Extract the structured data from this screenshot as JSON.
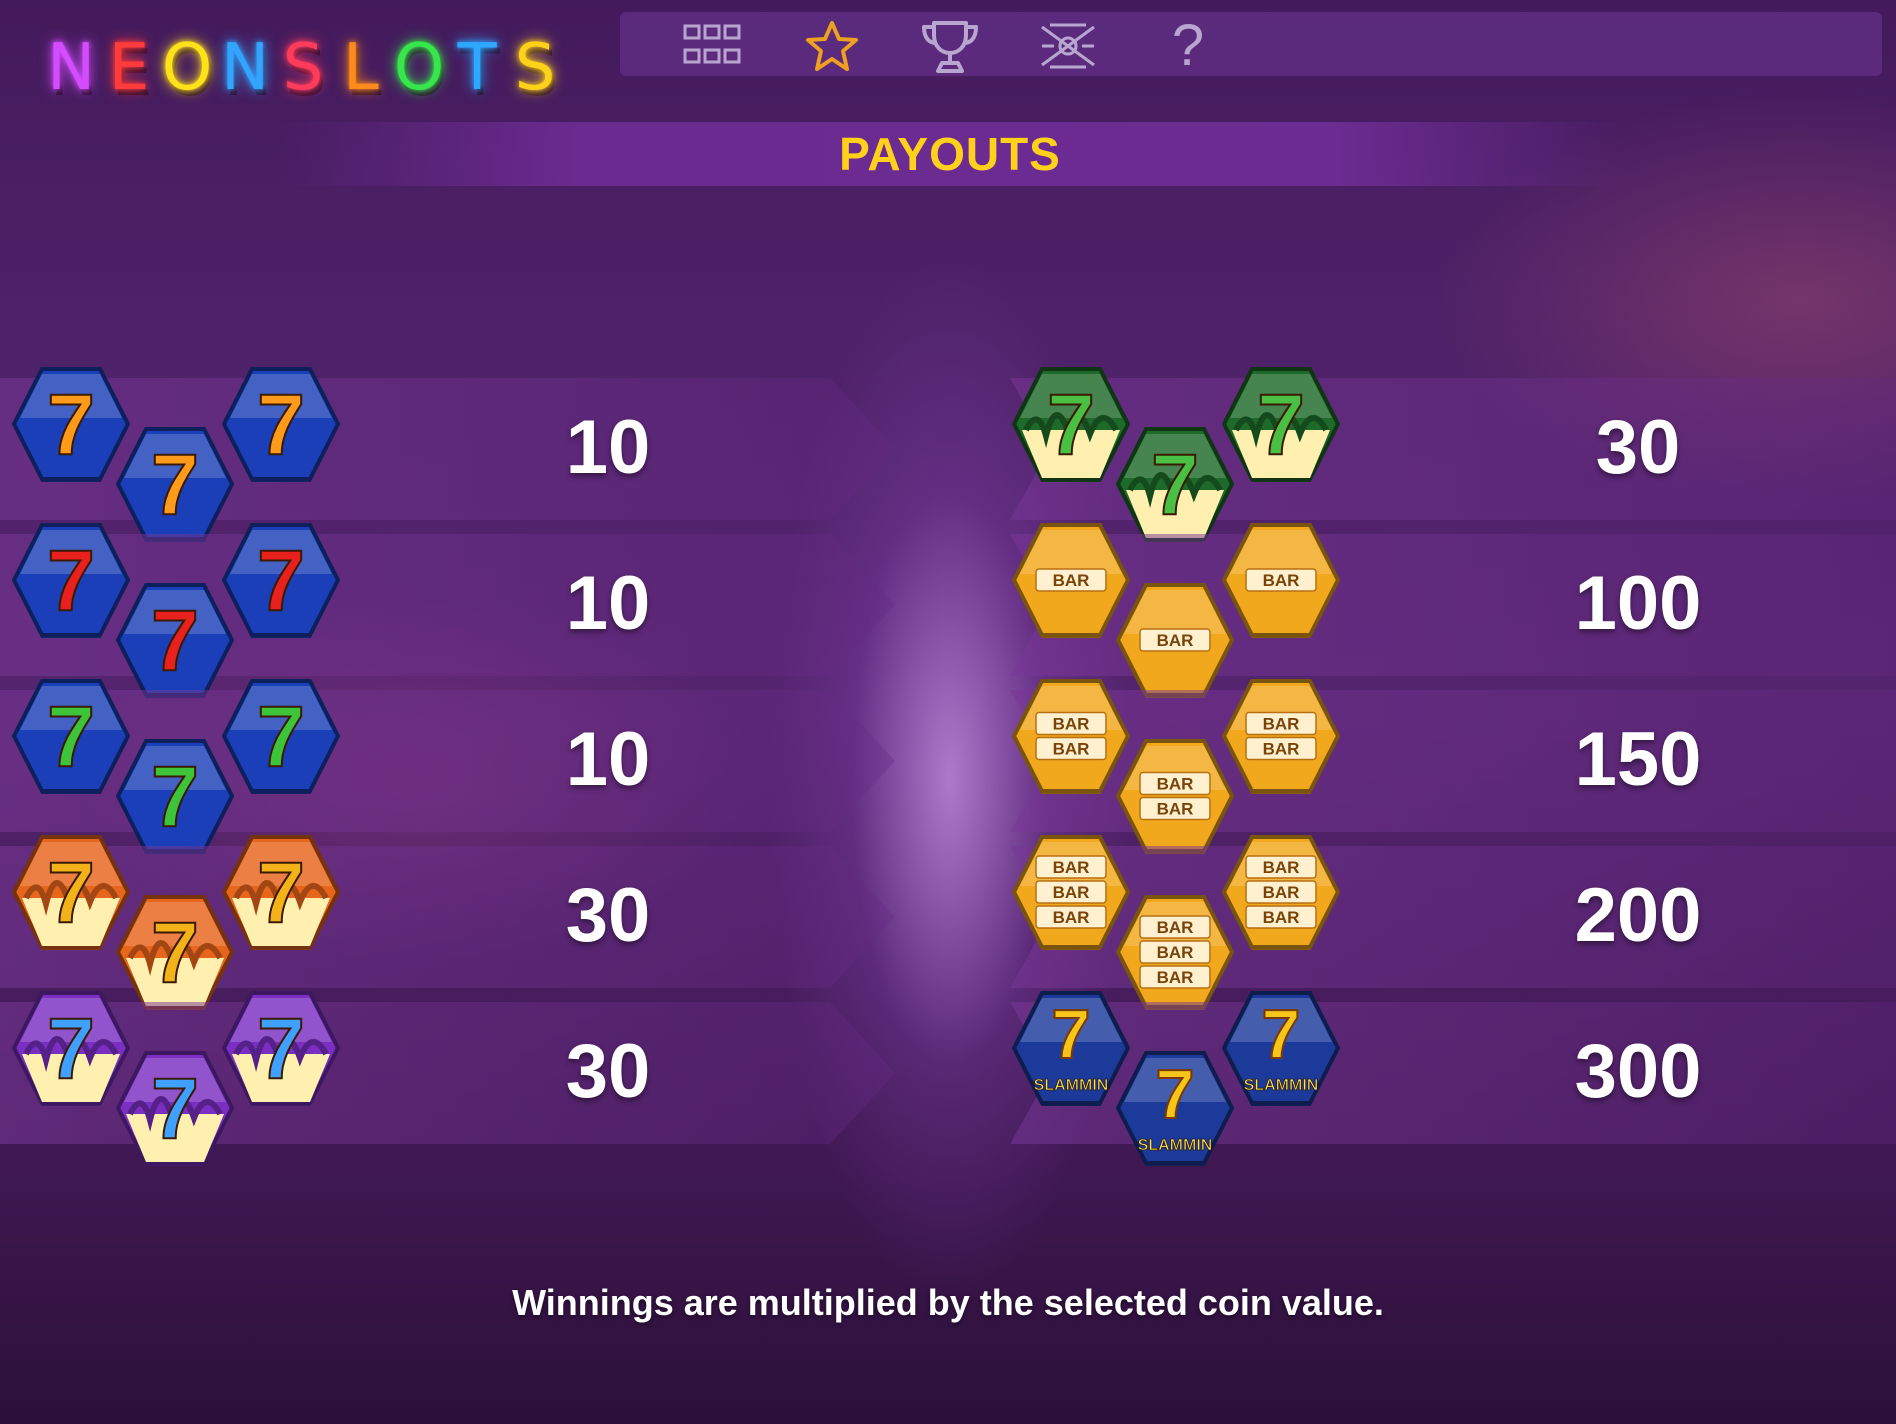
{
  "logo": {
    "letters": [
      "N",
      "E",
      "O",
      "N",
      "S",
      "L",
      "O",
      "T",
      "S"
    ],
    "colors": [
      "#d44cff",
      "#ff3b3b",
      "#ffe21a",
      "#33a4ff",
      "#ff3b5c",
      "#ff8c1a",
      "#36e64a",
      "#2ea8ff",
      "#ffd21a"
    ]
  },
  "nav": {
    "items": [
      {
        "name": "paytable-grid-icon",
        "icon": "grid-icon"
      },
      {
        "name": "favorites-star-icon",
        "icon": "star-icon",
        "color": "#f0a020"
      },
      {
        "name": "trophy-icon",
        "icon": "trophy-icon"
      },
      {
        "name": "settings-icon",
        "icon": "crossed-symbol-icon"
      },
      {
        "name": "help-icon",
        "icon": "question-mark-icon",
        "label": "?"
      }
    ]
  },
  "banner": {
    "title": "PAYOUTS"
  },
  "payouts": {
    "left": [
      {
        "symbol": "blue-gem-orange-seven",
        "gem": "#1b3fb8",
        "seven": "#ff9a1a",
        "value": "10"
      },
      {
        "symbol": "blue-gem-red-seven",
        "gem": "#1b3fb8",
        "seven": "#e8201e",
        "value": "10"
      },
      {
        "symbol": "blue-gem-green-seven",
        "gem": "#1b3fb8",
        "seven": "#3ec43a",
        "value": "10"
      },
      {
        "symbol": "flame-gem-red-seven",
        "gem": "#e8651c",
        "seven": "#f3b21a",
        "value": "30"
      },
      {
        "symbol": "flame-gem-purple-seven",
        "gem": "#7a2fc2",
        "seven": "#3fa0ff",
        "value": "30"
      }
    ],
    "right": [
      {
        "symbol": "green-flame-seven",
        "gem": "#1e6a2a",
        "seven": "#49c043",
        "value": "30"
      },
      {
        "symbol": "single-bar",
        "gem": "#f2a81c",
        "bars": 1,
        "label": "BAR",
        "value": "100"
      },
      {
        "symbol": "double-bar",
        "gem": "#f2a81c",
        "bars": 2,
        "label": "BAR",
        "value": "150"
      },
      {
        "symbol": "triple-bar",
        "gem": "#f2a81c",
        "bars": 3,
        "label": "BAR",
        "value": "200"
      },
      {
        "symbol": "slammin-seven",
        "gem": "#1b3a9a",
        "seven": "#f5c51c",
        "label": "SLAMMIN",
        "value": "300"
      }
    ]
  },
  "footer": {
    "note": "Winnings are multiplied by the selected coin value."
  }
}
